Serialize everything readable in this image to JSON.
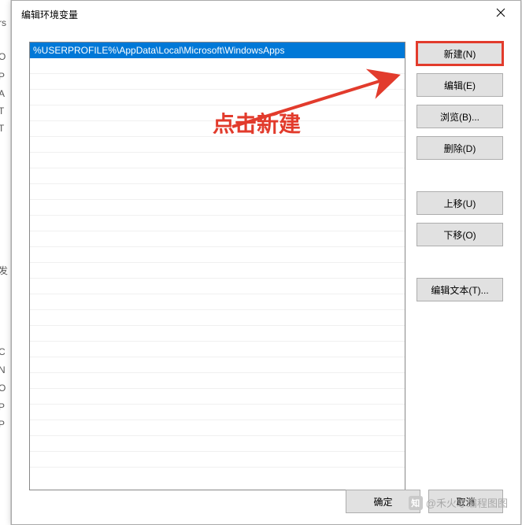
{
  "dialog": {
    "title": "编辑环境变量",
    "close_icon": "×"
  },
  "list": {
    "items": [
      "%USERPROFILE%\\AppData\\Local\\Microsoft\\WindowsApps"
    ]
  },
  "buttons": {
    "new": "新建(N)",
    "edit": "编辑(E)",
    "browse": "浏览(B)...",
    "delete": "删除(D)",
    "move_up": "上移(U)",
    "move_down": "下移(O)",
    "edit_text": "编辑文本(T)...",
    "ok": "确定",
    "cancel": "取消"
  },
  "annotation": {
    "text": "点击新建"
  },
  "watermark": {
    "prefix": "知乎",
    "text": "@禾火才编程图图"
  },
  "bg_fragments": [
    "rs",
    "O",
    "P",
    "A",
    "T",
    "T",
    "",
    "发",
    "",
    "",
    "C",
    "N",
    "O",
    "P",
    "P"
  ]
}
